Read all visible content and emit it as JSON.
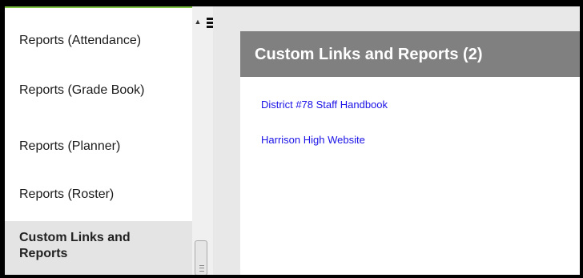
{
  "sidebar": {
    "items": [
      {
        "label": "Reports (Attendance)"
      },
      {
        "label": "Reports (Grade Book)"
      },
      {
        "label": "Reports (Planner)"
      },
      {
        "label": "Reports (Roster)"
      },
      {
        "label": "Custom Links and Reports",
        "active": true
      }
    ]
  },
  "icons": {
    "scroll_up": "scroll-up-arrow-icon",
    "menu": "hamburger-menu-icon"
  },
  "main": {
    "title": "Custom Links and Reports (2)",
    "links": [
      {
        "label": "District #78 Staff Handbook"
      },
      {
        "label": "Harrison High Website"
      }
    ]
  },
  "colors": {
    "header_bg": "#808080",
    "link": "#1a12e6",
    "active_item_bg": "#e4e4e4",
    "accent_border": "#7ec242"
  }
}
